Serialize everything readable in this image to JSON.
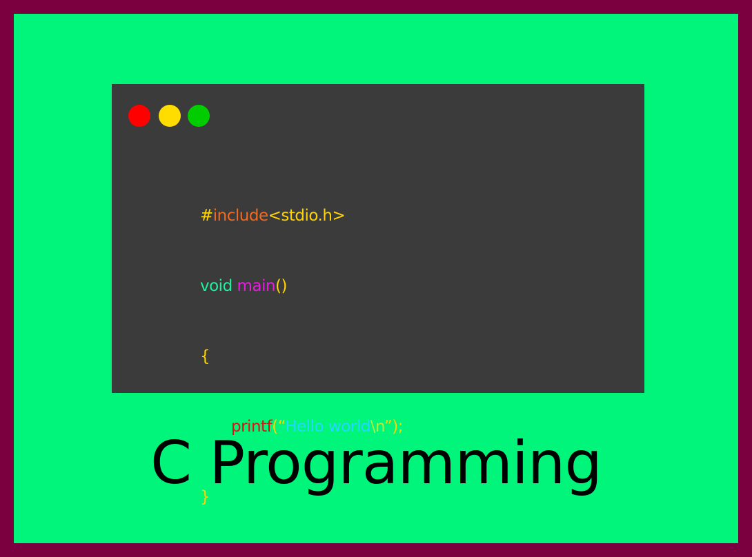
{
  "colors": {
    "border": "#7a0040",
    "background": "#00f57a",
    "editor_bg": "#3c3b3b",
    "dot_red": "#ff0000",
    "dot_yellow": "#ffdd00",
    "dot_green": "#00cc00",
    "hash": "#ffd400",
    "keyword_include": "#f26a1b",
    "header": "#ffd400",
    "type": "#1ef0a0",
    "function": "#e81ce0",
    "punct": "#ffd400",
    "printf": "#e01010",
    "string": "#22d8ff",
    "escape": "#b0f040",
    "title": "#000000"
  },
  "window_controls": [
    "close-dot",
    "minimize-dot",
    "maximize-dot"
  ],
  "code": {
    "line1": {
      "hash": "#",
      "keyword": "include",
      "header": "<stdio.h>"
    },
    "line2": {
      "type": "void",
      "space": " ",
      "func": "main",
      "parens": "()"
    },
    "line3": {
      "brace": "{"
    },
    "line4": {
      "func": "printf",
      "open": "(“",
      "text": "Hello world",
      "escape": "\\n",
      "close": "”);"
    },
    "line5": {
      "brace": "}"
    }
  },
  "title": "C Programming"
}
